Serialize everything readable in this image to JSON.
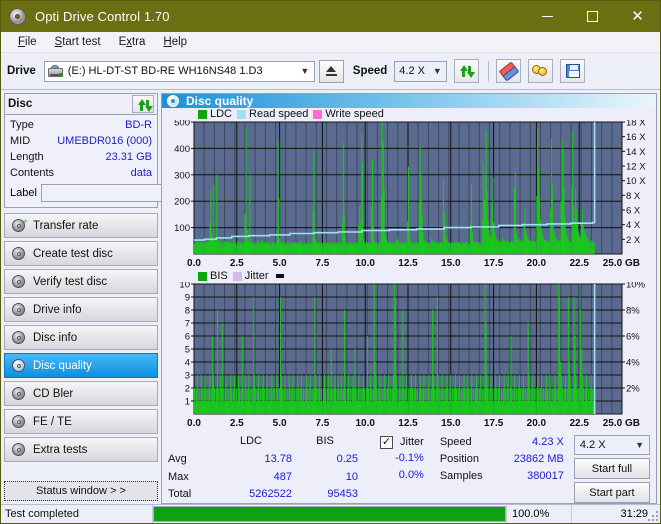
{
  "window": {
    "title": "Opti Drive Control 1.70",
    "icon": "disc-icon",
    "minimize_label": "–",
    "maximize_label": "□",
    "close_label": "✕"
  },
  "menu": {
    "items": [
      {
        "label": "File",
        "accel": "F"
      },
      {
        "label": "Start test",
        "accel": "S"
      },
      {
        "label": "Extra",
        "accel": "x"
      },
      {
        "label": "Help",
        "accel": "H"
      }
    ]
  },
  "toolbar": {
    "drive_label": "Drive",
    "drive_value": "(E:)  HL-DT-ST BD-RE  WH16NS48 1.D3",
    "eject_name": "eject-button",
    "speed_label": "Speed",
    "speed_value": "4.2 X",
    "refresh_name": "refresh-button",
    "erase_name": "erase-button",
    "bulbs_name": "tools-button",
    "save_name": "save-button"
  },
  "sidebar": {
    "disc_panel": {
      "title": "Disc",
      "refresh_button": "refresh-disc-button",
      "rows": [
        {
          "key": "Type",
          "value": "BD-R"
        },
        {
          "key": "MID",
          "value": "UMEBDR016 (000)"
        },
        {
          "key": "Length",
          "value": "23.31 GB"
        },
        {
          "key": "Contents",
          "value": "data"
        }
      ],
      "label_key": "Label",
      "label_value": "",
      "label_placeholder": ""
    },
    "nav": [
      {
        "label": "Transfer rate",
        "active": false
      },
      {
        "label": "Create test disc",
        "active": false
      },
      {
        "label": "Verify test disc",
        "active": false
      },
      {
        "label": "Drive info",
        "active": false
      },
      {
        "label": "Disc info",
        "active": false
      },
      {
        "label": "Disc quality",
        "active": true
      },
      {
        "label": "CD Bler",
        "active": false
      },
      {
        "label": "FE / TE",
        "active": false
      },
      {
        "label": "Extra tests",
        "active": false
      }
    ],
    "status_window_button": "Status window > >"
  },
  "main": {
    "panel_title": "Disc quality",
    "panel_icon": "disc-quality-icon"
  },
  "stats": {
    "col_ldc": "LDC",
    "col_bis": "BIS",
    "row_avg": "Avg",
    "row_max": "Max",
    "row_total": "Total",
    "ldc_avg": "13.78",
    "ldc_max": "487",
    "ldc_total": "5262522",
    "bis_avg": "0.25",
    "bis_max": "10",
    "bis_total": "95453",
    "jitter_label": "Jitter",
    "jitter_checked": true,
    "jitter_avg": "-0.1%",
    "jitter_max": "0.0%",
    "speed_label": "Speed",
    "speed_value": "4.23 X",
    "position_label": "Position",
    "position_value": "23862 MB",
    "samples_label": "Samples",
    "samples_value": "380017",
    "speed_select": "4.2 X",
    "start_full": "Start full",
    "start_part": "Start part"
  },
  "statusbar": {
    "message": "Test completed",
    "percent_label": "100.0%",
    "percent_value": 100,
    "elapsed": "31:29"
  },
  "colors": {
    "title_bar": "#6b6f12",
    "accent": "#1b1bd2",
    "plot_bg": "#5a6b8f",
    "ldc_green": "#17cc17",
    "read_speed": "#9fe0f5",
    "write_speed": "#ff6ad5",
    "jitter": "#d7b8e8",
    "progress": "#11a011",
    "active_nav": "#0c8fe0"
  },
  "chart_data": [
    {
      "type": "area",
      "name": "disc-quality-ldc-chart",
      "title": "",
      "xlabel": "GB",
      "ylabel": "",
      "xlim": [
        0,
        25
      ],
      "xticks": [
        "0.0",
        "2.5",
        "5.0",
        "7.5",
        "10.0",
        "12.5",
        "15.0",
        "17.5",
        "20.0",
        "22.5",
        "25.0 GB"
      ],
      "ylim": [
        0,
        500
      ],
      "yticks": [
        "100",
        "200",
        "300",
        "400",
        "500"
      ],
      "y2lim": [
        0,
        18
      ],
      "y2ticks": [
        "2 X",
        "4 X",
        "6 X",
        "8 X",
        "10 X",
        "12 X",
        "14 X",
        "16 X",
        "18 X"
      ],
      "grid": true,
      "legend": [
        {
          "label": "LDC",
          "color": "#0aa80a"
        },
        {
          "label": "Read speed",
          "color": "#9fe0f5"
        },
        {
          "label": "Write speed",
          "color": "#ff6ad5"
        }
      ],
      "data_end_gb": 23.4,
      "series": [
        {
          "name": "LDC",
          "color": "#17cc17",
          "x_step_gb": 0.0585,
          "values": [
            40,
            55,
            46,
            42,
            60,
            38,
            44,
            52,
            40,
            48,
            46,
            42,
            58,
            41,
            50,
            44,
            120,
            245,
            80,
            62,
            262,
            55,
            44,
            300,
            46,
            52,
            40,
            58,
            44,
            38,
            42,
            50,
            48,
            44,
            40,
            52,
            46,
            38,
            42,
            40,
            44,
            58,
            40,
            36,
            48,
            44,
            42,
            46,
            40,
            38,
            44,
            42,
            150,
            478,
            95,
            58,
            44,
            300,
            60,
            42,
            40,
            44,
            38,
            46,
            40,
            44,
            50,
            42,
            38,
            44,
            52,
            40,
            48,
            38,
            46,
            40,
            42,
            44,
            36,
            40,
            48,
            42,
            38,
            44,
            40,
            95,
            430,
            210,
            60,
            44,
            40,
            52,
            46,
            38,
            42,
            40,
            44,
            38,
            46,
            40,
            42,
            44,
            38,
            40,
            46,
            42,
            40,
            38,
            44,
            48,
            40,
            42,
            36,
            44,
            40,
            38,
            42,
            46,
            40,
            44,
            38,
            40,
            165,
            390,
            90,
            55,
            42,
            46,
            40,
            38,
            44,
            40,
            42,
            38,
            46,
            40,
            44,
            42,
            38,
            40,
            46,
            42,
            38,
            44,
            40,
            42,
            46,
            38,
            40,
            44,
            42,
            38,
            120,
            422,
            150,
            70,
            45,
            40,
            44,
            38,
            42,
            46,
            40,
            38,
            44,
            40,
            42,
            46,
            38,
            110,
            180,
            120,
            455,
            345,
            60,
            44,
            40,
            46,
            42,
            38,
            44,
            40,
            180,
            360,
            110,
            48,
            42,
            46,
            40,
            38,
            44,
            42,
            215,
            500,
            430,
            250,
            95,
            60,
            50,
            44,
            40,
            46,
            42,
            38,
            44,
            40,
            46,
            42,
            60,
            55,
            48,
            44,
            42,
            46,
            40,
            38,
            44,
            42,
            46,
            125,
            330,
            85,
            56,
            44,
            40,
            42,
            46,
            38,
            44,
            40,
            42,
            195,
            405,
            300,
            150,
            80,
            55,
            48,
            44,
            40,
            46,
            42,
            38,
            44,
            60,
            50,
            44,
            48,
            42,
            46,
            40,
            44,
            38,
            42,
            46,
            40,
            285,
            160,
            95,
            62,
            50,
            46,
            42,
            40,
            44,
            38,
            42,
            46,
            40,
            44,
            48,
            42,
            46,
            40,
            44,
            38,
            42,
            46,
            40,
            44,
            48,
            42,
            40,
            38,
            120,
            265,
            80,
            50,
            44,
            48,
            42,
            46,
            40,
            44,
            38,
            42,
            130,
            345,
            205,
            300,
            470,
            240,
            130,
            90,
            70,
            60,
            190,
            290,
            120,
            80,
            60,
            55,
            48,
            52,
            46,
            50,
            44,
            60,
            55,
            50,
            46,
            52,
            44,
            48,
            42,
            46,
            50,
            44,
            48,
            250,
            310,
            80,
            65,
            55,
            60,
            50,
            54,
            46,
            50,
            120,
            170,
            90,
            70,
            60,
            55,
            50,
            48,
            52,
            46,
            50,
            44,
            48,
            220,
            475,
            330,
            215,
            130,
            95,
            72,
            60,
            55,
            50,
            46,
            52,
            44,
            48,
            170,
            440,
            260,
            120,
            85,
            65,
            58,
            50,
            54,
            46,
            50,
            200,
            435,
            395,
            255,
            140,
            95,
            70,
            60,
            55,
            50,
            46,
            260,
            465,
            180,
            120,
            250,
            170,
            110,
            85,
            70,
            60,
            120,
            170,
            110,
            90,
            80,
            70,
            60,
            55,
            50,
            46,
            52,
            44,
            48,
            42
          ]
        },
        {
          "name": "Read speed",
          "color": "#9fe0f5",
          "description": "Stepped increasing read speed curve from about 2.0X at 0 GB to about 4.3X at 23.4 GB, with a vertical spike to 18X at the end of recorded data",
          "points_gb_x": [
            0.0,
            0.6,
            1.3,
            2.2,
            3.2,
            4.4,
            5.6,
            7.0,
            8.4,
            9.8,
            11.4,
            13.0,
            14.6,
            16.2,
            17.8,
            19.2,
            20.6,
            22.0,
            23.3,
            23.4
          ],
          "points_x_speed": [
            1.9,
            2.0,
            2.2,
            2.4,
            2.5,
            2.6,
            2.8,
            2.9,
            3.0,
            3.2,
            3.3,
            3.4,
            3.6,
            3.7,
            3.9,
            4.0,
            4.1,
            4.2,
            4.3,
            18.0
          ]
        },
        {
          "name": "Write speed",
          "color": "#ff6ad5",
          "values": []
        }
      ]
    },
    {
      "type": "area",
      "name": "disc-quality-bis-chart",
      "title": "",
      "xlabel": "GB",
      "ylabel": "",
      "xlim": [
        0,
        25
      ],
      "xticks": [
        "0.0",
        "2.5",
        "5.0",
        "7.5",
        "10.0",
        "12.5",
        "15.0",
        "17.5",
        "20.0",
        "22.5",
        "25.0 GB"
      ],
      "ylim": [
        0,
        10
      ],
      "yticks": [
        "1",
        "2",
        "3",
        "4",
        "5",
        "6",
        "7",
        "8",
        "9",
        "10"
      ],
      "y2lim": [
        0,
        10
      ],
      "y2ticks": [
        "2%",
        "4%",
        "6%",
        "8%",
        "10%"
      ],
      "grid": true,
      "legend": [
        {
          "label": "BIS",
          "color": "#0aa80a"
        },
        {
          "label": "Jitter",
          "color": "#d7b8e8"
        }
      ],
      "data_end_gb": 23.4,
      "series": [
        {
          "name": "BIS",
          "color": "#17cc17",
          "x_step_gb": 0.0585,
          "description": "Dense noise floor around 1-3 with frequent spikes to 4-10",
          "values": [
            2,
            1,
            2,
            3,
            1,
            2,
            1,
            3,
            2,
            1,
            2,
            3,
            1,
            2,
            1,
            2,
            3,
            1,
            2,
            6,
            3,
            2,
            1,
            2,
            8,
            2,
            1,
            3,
            2,
            7,
            2,
            1,
            2,
            3,
            1,
            2,
            1,
            2,
            3,
            2,
            1,
            2,
            3,
            1,
            2,
            1,
            3,
            2,
            1,
            2,
            6,
            2,
            1,
            3,
            2,
            1,
            2,
            3,
            1,
            2,
            1,
            2,
            9,
            3,
            2,
            1,
            2,
            3,
            1,
            2,
            1,
            2,
            3,
            2,
            1,
            2,
            3,
            1,
            2,
            1,
            2,
            3,
            1,
            2,
            2,
            1,
            3,
            2,
            1,
            2,
            9,
            3,
            2,
            1,
            2,
            3,
            1,
            2,
            1,
            3,
            2,
            1,
            2,
            3,
            1,
            2,
            1,
            2,
            3,
            2,
            1,
            2,
            3,
            1,
            2,
            1,
            2,
            3,
            2,
            1,
            2,
            3,
            1,
            2,
            1,
            2,
            9,
            3,
            2,
            1,
            2,
            3,
            1,
            2,
            1,
            2,
            3,
            2,
            1,
            2,
            3,
            1,
            2,
            5,
            2,
            1,
            2,
            3,
            2,
            1,
            3,
            2,
            1,
            2,
            3,
            1,
            2,
            8,
            2,
            1,
            2,
            3,
            1,
            2,
            1,
            2,
            3,
            2,
            5,
            2,
            1,
            2,
            3,
            1,
            2,
            1,
            2,
            3,
            2,
            1,
            2,
            6,
            2,
            1,
            3,
            2,
            1,
            2,
            10,
            4,
            3,
            2,
            1,
            2,
            3,
            1,
            2,
            1,
            2,
            3,
            2,
            1,
            2,
            3,
            1,
            2,
            1,
            2,
            3,
            10,
            9,
            3,
            2,
            1,
            2,
            3,
            1,
            2,
            8,
            2,
            1,
            2,
            3,
            1,
            2,
            1,
            2,
            3,
            2,
            1,
            2,
            3,
            1,
            2,
            1,
            2,
            3,
            2,
            1,
            2,
            3,
            1,
            2,
            1,
            2,
            3,
            2,
            1,
            2,
            8,
            3,
            2,
            1,
            2,
            9,
            3,
            2,
            1,
            2,
            3,
            1,
            2,
            1,
            2,
            3,
            2,
            1,
            2,
            3,
            1,
            2,
            1,
            2,
            3,
            2,
            1,
            2,
            3,
            1,
            2,
            1,
            2,
            3,
            2,
            1,
            2,
            3,
            2,
            1,
            2,
            3,
            1,
            2,
            1,
            2,
            3,
            2,
            1,
            2,
            3,
            1,
            2,
            1,
            2,
            10,
            7,
            3,
            2,
            1,
            2,
            3,
            1,
            2,
            1,
            2,
            3,
            2,
            1,
            2,
            3,
            1,
            2,
            1,
            2,
            3,
            2,
            1,
            2,
            3,
            1,
            2,
            6,
            2,
            1,
            2,
            3,
            1,
            2,
            1,
            2,
            3,
            2,
            1,
            2,
            3,
            1,
            2,
            1,
            2,
            7,
            3,
            2,
            1,
            2,
            3,
            1,
            2,
            1,
            2,
            3,
            2,
            1,
            2,
            3,
            1,
            2,
            1,
            2,
            3,
            2,
            1,
            2,
            3,
            1,
            2,
            1,
            2,
            3,
            2,
            1,
            2,
            10,
            9,
            4,
            3,
            2,
            1,
            2,
            3,
            1,
            2,
            9,
            4,
            3,
            2,
            1,
            2,
            9,
            6,
            3,
            2,
            1,
            2,
            10,
            8,
            5,
            3,
            2,
            1,
            2,
            3,
            1,
            2,
            1,
            2,
            3,
            2,
            1,
            2
          ]
        },
        {
          "name": "Jitter",
          "color": "#d7b8e8",
          "values": []
        }
      ]
    }
  ]
}
